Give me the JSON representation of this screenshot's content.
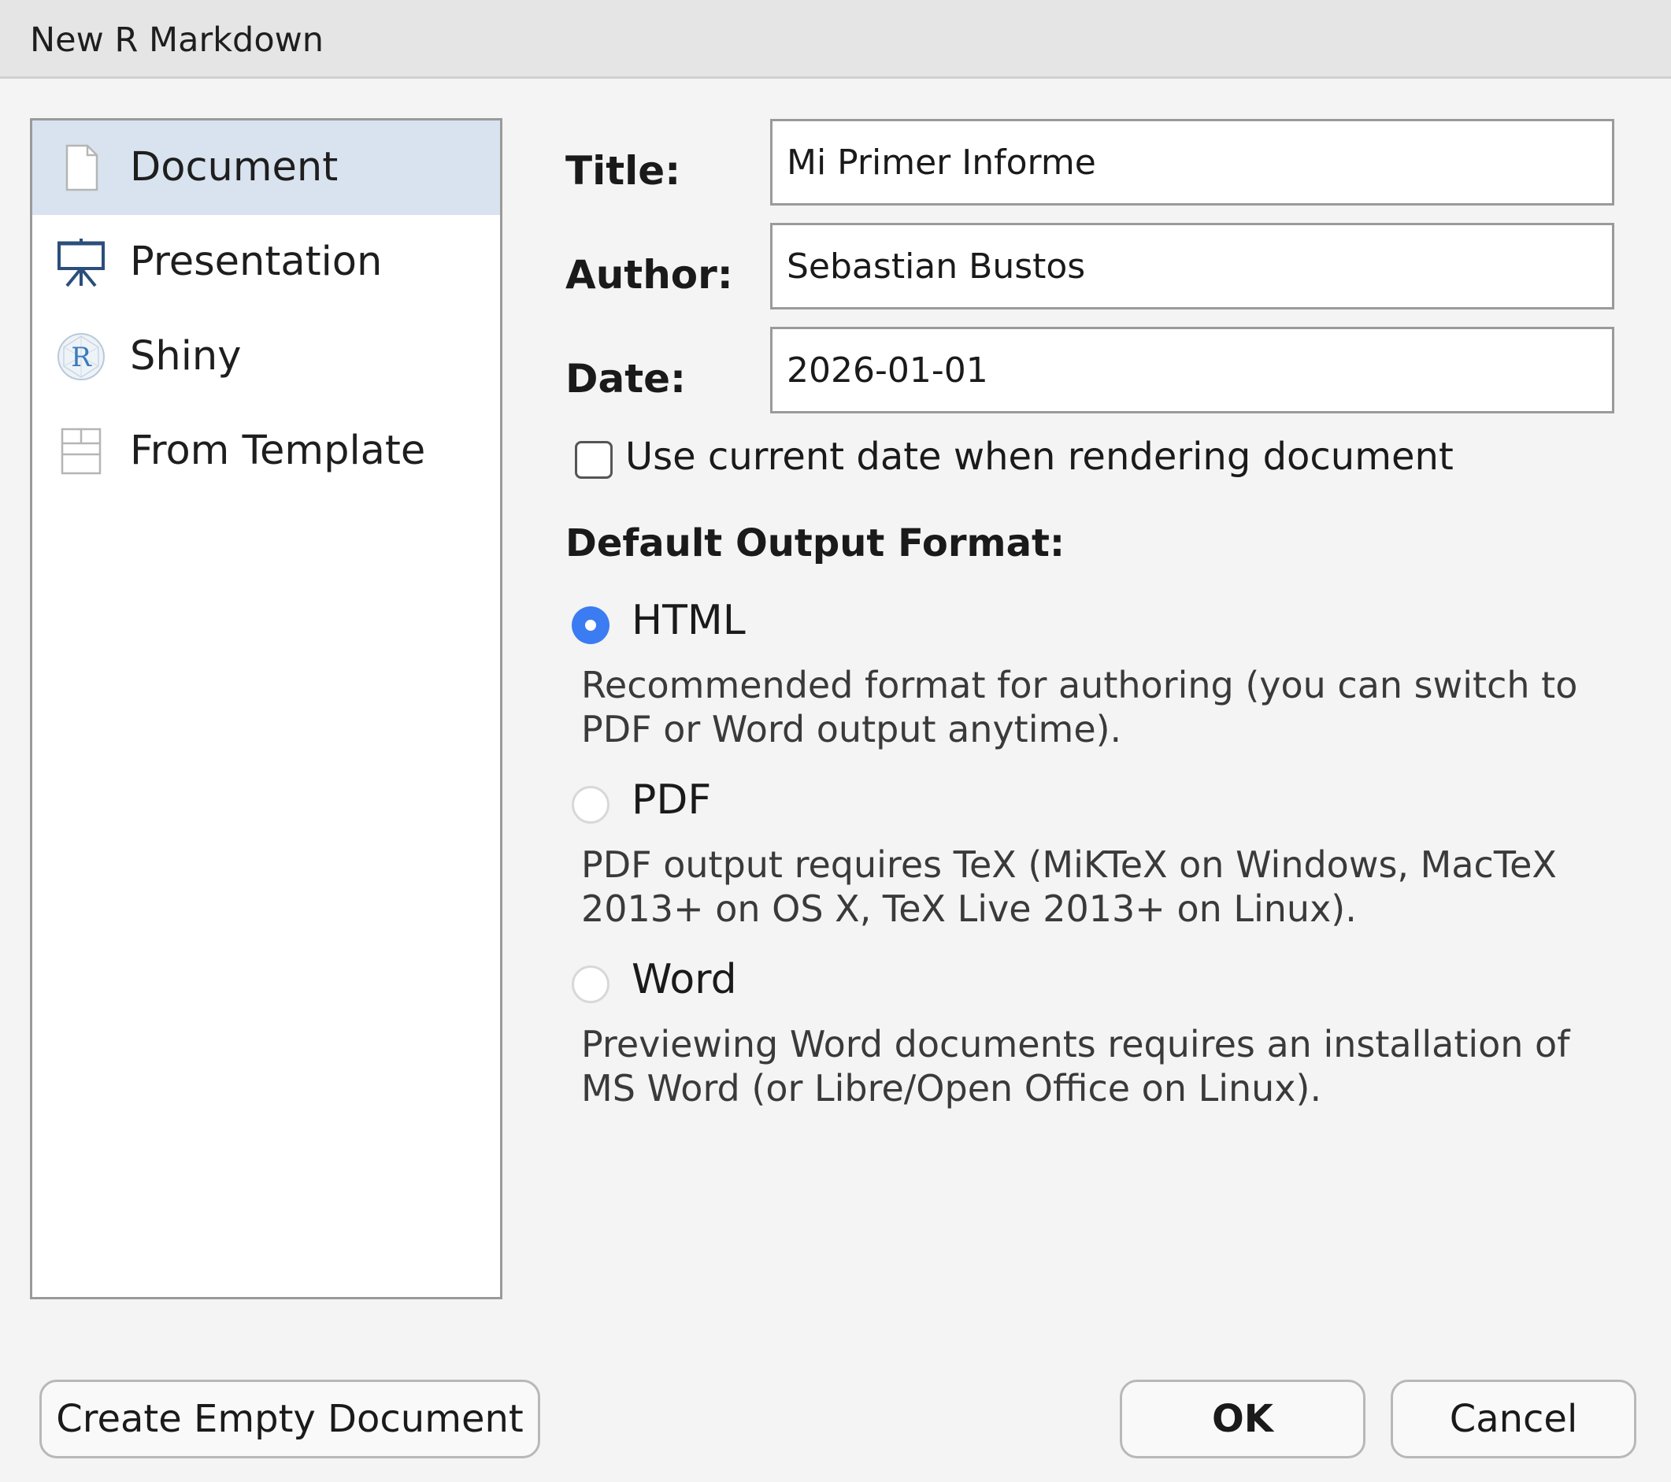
{
  "window": {
    "title": "New R Markdown"
  },
  "types": [
    {
      "label": "Document",
      "icon": "document-icon",
      "selected": true
    },
    {
      "label": "Presentation",
      "icon": "presentation-easel-icon",
      "selected": false
    },
    {
      "label": "Shiny",
      "icon": "shiny-r-logo-icon",
      "selected": false
    },
    {
      "label": "From Template",
      "icon": "template-grid-icon",
      "selected": false
    }
  ],
  "form": {
    "title_label": "Title:",
    "title_value": "Mi Primer Informe",
    "author_label": "Author:",
    "author_value": "Sebastian Bustos",
    "date_label": "Date:",
    "date_value": "2026-01-01",
    "use_current_date_label": "Use current date when rendering document",
    "use_current_date_checked": false
  },
  "output": {
    "heading": "Default Output Format:",
    "selected": "HTML",
    "options": [
      {
        "label": "HTML",
        "description": "Recommended format for authoring (you can switch to PDF or Word output anytime)."
      },
      {
        "label": "PDF",
        "description": "PDF output requires TeX (MiKTeX on Windows, MacTeX 2013+ on OS X, TeX Live 2013+ on Linux)."
      },
      {
        "label": "Word",
        "description": "Previewing Word documents requires an installation of MS Word (or Libre/Open Office on Linux)."
      }
    ]
  },
  "buttons": {
    "create_empty": "Create Empty Document",
    "ok": "OK",
    "cancel": "Cancel"
  },
  "colors": {
    "accent": "#3b7cf2",
    "selected_row": "#d8e3ef",
    "icon_blue": "#2b4f7a"
  }
}
